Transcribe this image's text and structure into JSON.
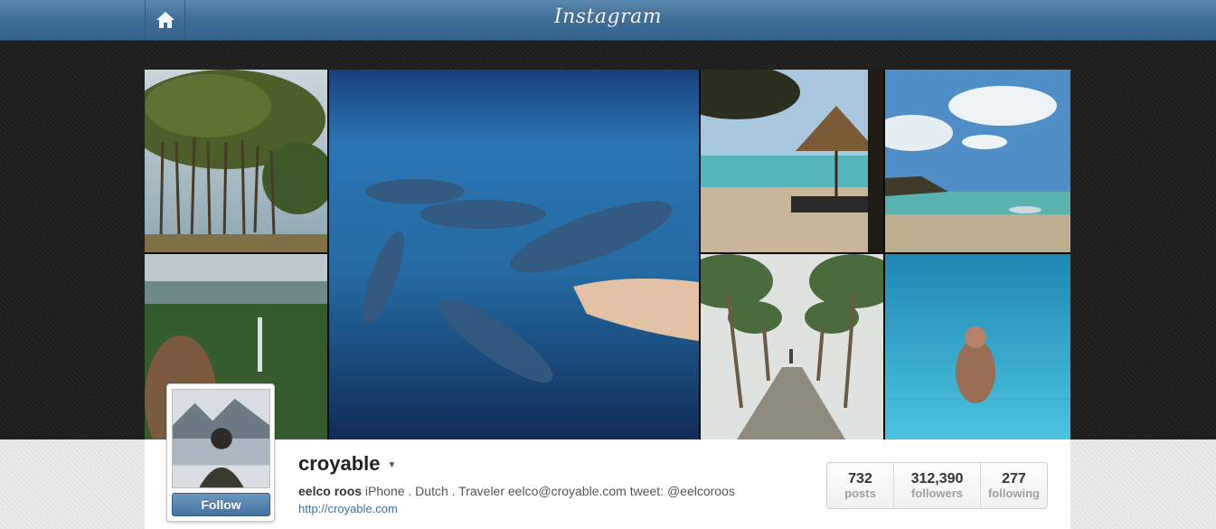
{
  "header": {
    "logo": "Instagram",
    "home_icon": "home-icon"
  },
  "gallery": {
    "photos": [
      {
        "name": "banyan-trees"
      },
      {
        "name": "dolphins-underwater"
      },
      {
        "name": "beach-umbrella"
      },
      {
        "name": "lagoon-clouds"
      },
      {
        "name": "waterfall-valley"
      },
      {
        "name": "palm-path"
      },
      {
        "name": "swimmer-pool"
      }
    ]
  },
  "profile": {
    "username": "croyable",
    "full_name": "eelco roos",
    "bio": " iPhone . Dutch . Traveler eelco@croyable.com tweet: @eelcoroos",
    "website": "http://croyable.com",
    "follow_label": "Follow",
    "caret_icon": "caret-down-icon"
  },
  "stats": [
    {
      "value": "732",
      "label": "posts"
    },
    {
      "value": "312,390",
      "label": "followers"
    },
    {
      "value": "277",
      "label": "following"
    }
  ],
  "colors": {
    "nav_blue": "#3f6e95",
    "link_blue": "#3f729b"
  }
}
